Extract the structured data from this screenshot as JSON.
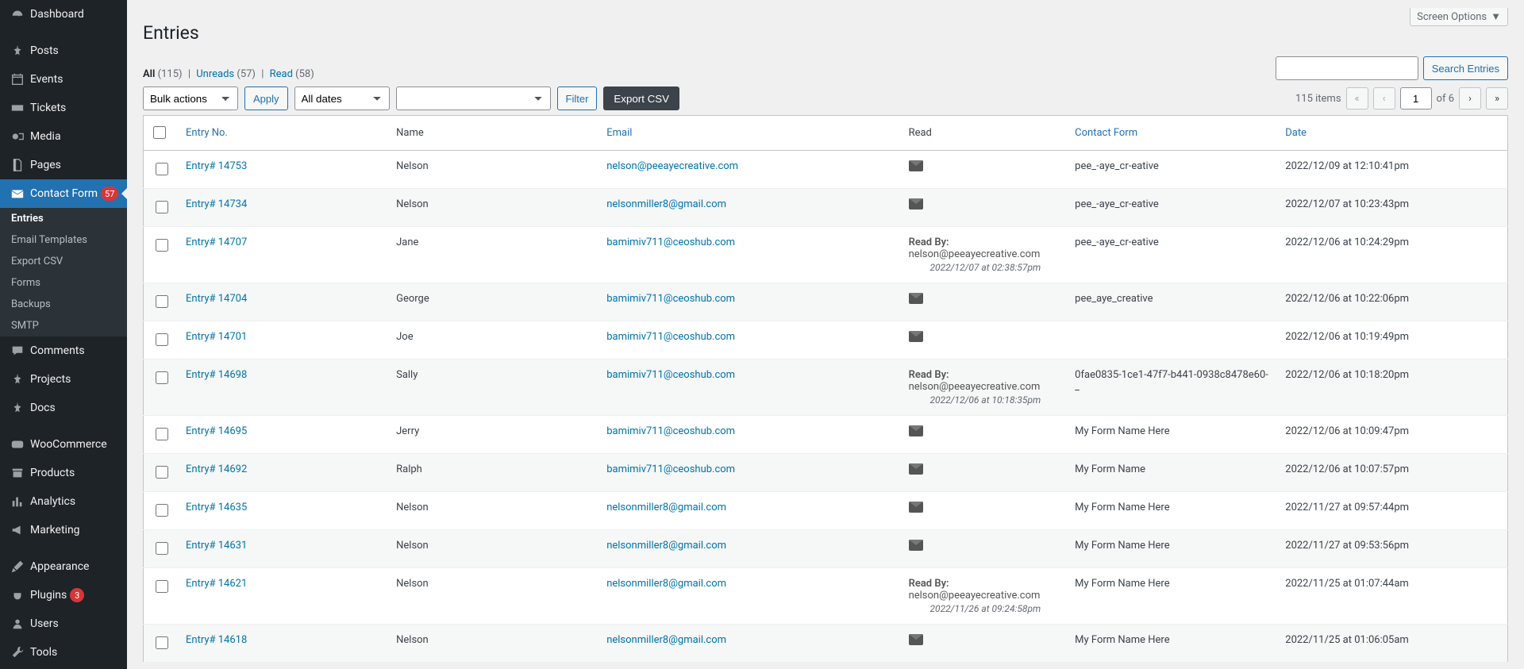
{
  "topbar": {
    "screen_options": "Screen Options"
  },
  "page": {
    "title": "Entries"
  },
  "sidebar": {
    "items": [
      {
        "id": "dashboard",
        "label": "Dashboard",
        "icon": "dashboard"
      },
      {
        "sep": true
      },
      {
        "id": "posts",
        "label": "Posts",
        "icon": "pin"
      },
      {
        "id": "events",
        "label": "Events",
        "icon": "calendar"
      },
      {
        "id": "tickets",
        "label": "Tickets",
        "icon": "ticket"
      },
      {
        "id": "media",
        "label": "Media",
        "icon": "media"
      },
      {
        "id": "pages",
        "label": "Pages",
        "icon": "page"
      },
      {
        "id": "contact-form",
        "label": "Contact Form",
        "icon": "mail",
        "badge": "57",
        "active": true,
        "submenu": [
          {
            "id": "entries",
            "label": "Entries",
            "current": true
          },
          {
            "id": "email-templates",
            "label": "Email Templates"
          },
          {
            "id": "export-csv",
            "label": "Export CSV"
          },
          {
            "id": "forms",
            "label": "Forms"
          },
          {
            "id": "backups",
            "label": "Backups"
          },
          {
            "id": "smtp",
            "label": "SMTP"
          }
        ]
      },
      {
        "id": "comments",
        "label": "Comments",
        "icon": "comment"
      },
      {
        "id": "projects",
        "label": "Projects",
        "icon": "pin"
      },
      {
        "id": "docs",
        "label": "Docs",
        "icon": "pin"
      },
      {
        "sep": true
      },
      {
        "id": "woocommerce",
        "label": "WooCommerce",
        "icon": "woo"
      },
      {
        "id": "products",
        "label": "Products",
        "icon": "archive"
      },
      {
        "id": "analytics",
        "label": "Analytics",
        "icon": "chart"
      },
      {
        "id": "marketing",
        "label": "Marketing",
        "icon": "megaphone"
      },
      {
        "sep": true
      },
      {
        "id": "appearance",
        "label": "Appearance",
        "icon": "brush"
      },
      {
        "id": "plugins",
        "label": "Plugins",
        "icon": "plug",
        "badge": "3"
      },
      {
        "id": "users",
        "label": "Users",
        "icon": "user"
      },
      {
        "id": "tools",
        "label": "Tools",
        "icon": "wrench"
      }
    ]
  },
  "filters": {
    "all_label": "All",
    "all_count": "(115)",
    "unreads_label": "Unreads",
    "unreads_count": "(57)",
    "read_label": "Read",
    "read_count": "(58)"
  },
  "search": {
    "placeholder": "",
    "button": "Search Entries"
  },
  "actions": {
    "bulk_label": "Bulk actions",
    "apply": "Apply",
    "all_dates": "All dates",
    "form_filter_placeholder": "",
    "filter": "Filter",
    "export_csv": "Export CSV"
  },
  "pagination": {
    "items_label": "115 items",
    "current_page": "1",
    "of_label": "of 6",
    "first": "«",
    "prev": "‹",
    "next": "›",
    "last": "»"
  },
  "columns": {
    "entry_no": "Entry No.",
    "name": "Name",
    "email": "Email",
    "read": "Read",
    "contact_form": "Contact Form",
    "date": "Date"
  },
  "rows": [
    {
      "entry": "Entry# 14753",
      "name": "Nelson",
      "email": "nelson@peeayecreative.com",
      "read_type": "unread",
      "form": "pee_-aye_cr-eative",
      "date": "2022/12/09 at 12:10:41pm"
    },
    {
      "entry": "Entry# 14734",
      "name": "Nelson",
      "email": "nelsonmiller8@gmail.com",
      "read_type": "unread",
      "form": "pee_-aye_cr-eative",
      "date": "2022/12/07 at 10:23:43pm"
    },
    {
      "entry": "Entry# 14707",
      "name": "Jane",
      "email": "bamimiv711@ceoshub.com",
      "read_type": "read",
      "read_by_label": "Read By:",
      "read_by": "nelson@peeayecreative.com",
      "read_time": "2022/12/07 at 02:38:57pm",
      "form": "pee_-aye_cr-eative",
      "date": "2022/12/06 at 10:24:29pm"
    },
    {
      "entry": "Entry# 14704",
      "name": "George",
      "email": "bamimiv711@ceoshub.com",
      "read_type": "unread",
      "form": "pee_aye_creative",
      "date": "2022/12/06 at 10:22:06pm"
    },
    {
      "entry": "Entry# 14701",
      "name": "Joe",
      "email": "bamimiv711@ceoshub.com",
      "read_type": "unread",
      "form": "",
      "date": "2022/12/06 at 10:19:49pm"
    },
    {
      "entry": "Entry# 14698",
      "name": "Sally",
      "email": "bamimiv711@ceoshub.com",
      "read_type": "read",
      "read_by_label": "Read By:",
      "read_by": "nelson@peeayecreative.com",
      "read_time": "2022/12/06 at 10:18:35pm",
      "form": "0fae0835-1ce1-47f7-b441-0938c8478e60-_",
      "date": "2022/12/06 at 10:18:20pm"
    },
    {
      "entry": "Entry# 14695",
      "name": "Jerry",
      "email": "bamimiv711@ceoshub.com",
      "read_type": "unread",
      "form": "My Form Name Here",
      "date": "2022/12/06 at 10:09:47pm"
    },
    {
      "entry": "Entry# 14692",
      "name": "Ralph",
      "email": "bamimiv711@ceoshub.com",
      "read_type": "unread",
      "form": "My Form Name",
      "date": "2022/12/06 at 10:07:57pm"
    },
    {
      "entry": "Entry# 14635",
      "name": "Nelson",
      "email": "nelsonmiller8@gmail.com",
      "read_type": "unread",
      "form": "My Form Name Here",
      "date": "2022/11/27 at 09:57:44pm"
    },
    {
      "entry": "Entry# 14631",
      "name": "Nelson",
      "email": "nelsonmiller8@gmail.com",
      "read_type": "unread",
      "form": "My Form Name Here",
      "date": "2022/11/27 at 09:53:56pm"
    },
    {
      "entry": "Entry# 14621",
      "name": "Nelson",
      "email": "nelsonmiller8@gmail.com",
      "read_type": "read",
      "read_by_label": "Read By:",
      "read_by": "nelson@peeayecreative.com",
      "read_time": "2022/11/26 at 09:24:58pm",
      "form": "My Form Name Here",
      "date": "2022/11/25 at 01:07:44am"
    },
    {
      "entry": "Entry# 14618",
      "name": "Nelson",
      "email": "nelsonmiller8@gmail.com",
      "read_type": "unread",
      "form": "My Form Name Here",
      "date": "2022/11/25 at 01:06:05am"
    }
  ]
}
